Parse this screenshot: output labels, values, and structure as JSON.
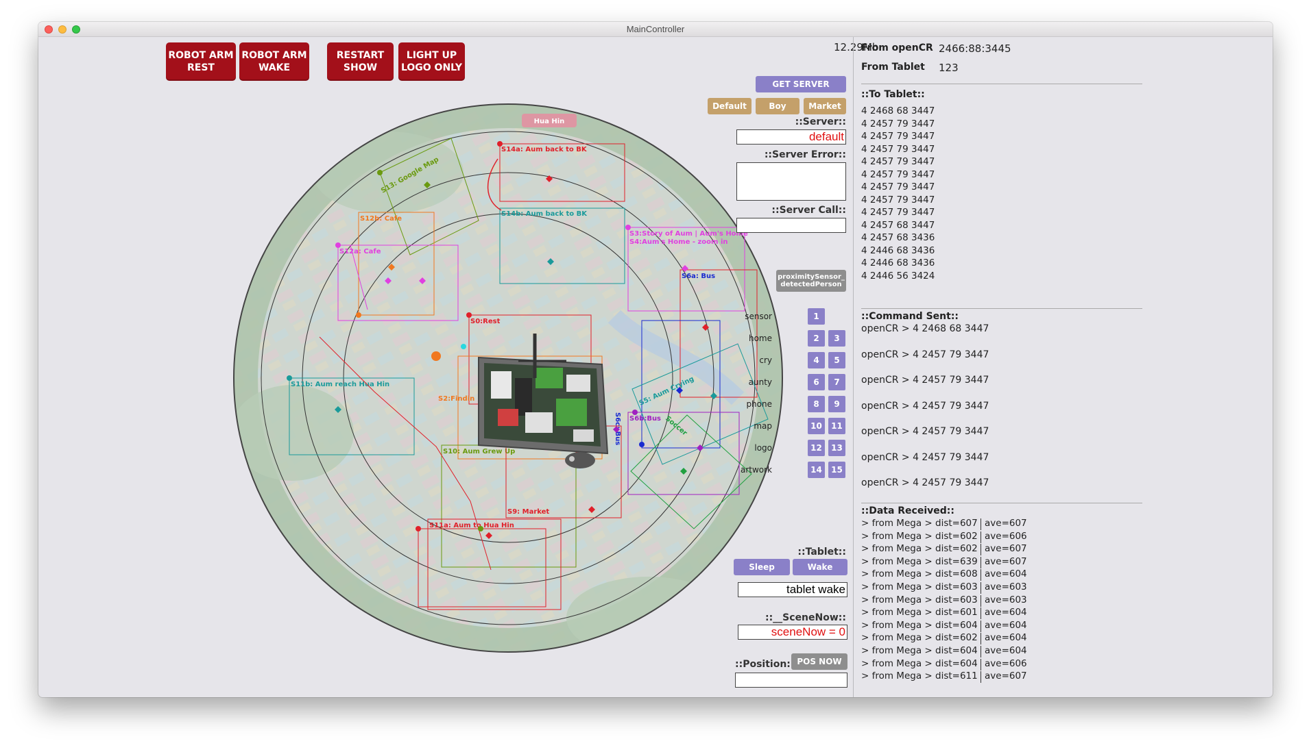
{
  "window": {
    "title": "MainController"
  },
  "top_buttons": [
    {
      "label": "ROBOT ARM\nREST"
    },
    {
      "label": "ROBOT ARM\nWAKE"
    },
    {
      "label": "RESTART\nSHOW"
    },
    {
      "label": "LIGHT UP\nLOGO ONLY"
    }
  ],
  "memory": "12.29Mb",
  "server": {
    "get_server_label": "GET SERVER",
    "presets": [
      "Default",
      "Boy",
      "Market"
    ],
    "server_label": "::Server::",
    "server_value": "default",
    "server_error_label": "::Server Error::",
    "server_error_value": "",
    "server_call_label": "::Server Call::",
    "server_call_value": ""
  },
  "proximity_button": "proximitySensor_\ndetectedPerson",
  "command_grid": [
    {
      "label": "sensor",
      "buttons": [
        "1"
      ]
    },
    {
      "label": "home",
      "buttons": [
        "2",
        "3"
      ]
    },
    {
      "label": "cry",
      "buttons": [
        "4",
        "5"
      ]
    },
    {
      "label": "aunty",
      "buttons": [
        "6",
        "7"
      ]
    },
    {
      "label": "phone",
      "buttons": [
        "8",
        "9"
      ]
    },
    {
      "label": "map",
      "buttons": [
        "10",
        "11"
      ]
    },
    {
      "label": "logo",
      "buttons": [
        "12",
        "13"
      ]
    },
    {
      "label": "artwork",
      "buttons": [
        "14",
        "15"
      ]
    }
  ],
  "tablet": {
    "label": "::Tablet::",
    "sleep_label": "Sleep",
    "wake_label": "Wake",
    "value": "tablet wake"
  },
  "scene_now": {
    "label": "::__SceneNow::",
    "value": "sceneNow = 0"
  },
  "position": {
    "label": "::Position::",
    "button": "POS NOW",
    "value": ""
  },
  "right_panel": {
    "from_opencr_label": "From openCR",
    "from_opencr_value": "2466:88:3445",
    "from_tablet_label": "From Tablet",
    "from_tablet_value": "123",
    "to_tablet_header": "::To Tablet::",
    "to_tablet_lines": [
      "4 2468 68 3447",
      "4 2457 79 3447",
      "4 2457 79 3447",
      "4 2457 79 3447",
      "4 2457 79 3447",
      "4 2457 79 3447",
      "4 2457 79 3447",
      "4 2457 79 3447",
      "4 2457 79 3447",
      "4 2457 68 3447",
      "4 2457 68 3436",
      "4 2446 68 3436",
      "4 2446 68 3436",
      "4 2446 56 3424"
    ],
    "command_sent_header": "::Command Sent::",
    "command_sent_lines": [
      "openCR > 4 2468 68 3447",
      "openCR > 4 2457 79 3447",
      "openCR > 4 2457 79 3447",
      "openCR > 4 2457 79 3447",
      "openCR > 4 2457 79 3447",
      "openCR > 4 2457 79 3447",
      "openCR > 4 2457 79 3447"
    ],
    "data_received_header": "::Data Received::",
    "data_received_lines": [
      {
        "left": "> from Mega > dist=607",
        "right": "ave=607"
      },
      {
        "left": "> from Mega > dist=602",
        "right": "ave=606"
      },
      {
        "left": "> from Mega > dist=602",
        "right": "ave=607"
      },
      {
        "left": "> from Mega > dist=639",
        "right": "ave=607"
      },
      {
        "left": "> from Mega > dist=608",
        "right": "ave=604"
      },
      {
        "left": "> from Mega > dist=603",
        "right": "ave=603"
      },
      {
        "left": "> from Mega > dist=603",
        "right": "ave=603"
      },
      {
        "left": "> from Mega > dist=601",
        "right": "ave=604"
      },
      {
        "left": "> from Mega > dist=604",
        "right": "ave=604"
      },
      {
        "left": "> from Mega > dist=602",
        "right": "ave=604"
      },
      {
        "left": "> from Mega > dist=604",
        "right": "ave=604"
      },
      {
        "left": "> from Mega > dist=604",
        "right": "ave=606"
      },
      {
        "left": "> from Mega > dist=611",
        "right": "ave=607"
      }
    ]
  },
  "map": {
    "town_label": "Hua Hin",
    "scenes": [
      {
        "label": "S14a: Aum back to BK",
        "color": "#e0202a"
      },
      {
        "label": "S14b: Aum back to BK",
        "color": "#1a9a9a"
      },
      {
        "label": "S13: Google Map",
        "color": "#6a9a10"
      },
      {
        "label": "S12b: Cafe",
        "color": "#f07820"
      },
      {
        "label": "S12a: Cafe",
        "color": "#e040e0"
      },
      {
        "label": "S3:Story of Aum | Aum's Home",
        "color": "#e040e0"
      },
      {
        "label": "S4:Aum's Home - zoom in",
        "color": "#e040e0"
      },
      {
        "label": "S6a: Bus",
        "color": "#1a2ad0"
      },
      {
        "label": "S0:Rest",
        "color": "#e0202a"
      },
      {
        "label": "S2:Findin",
        "color": "#f07820"
      },
      {
        "label": "S11b: Aum reach Hua Hin",
        "color": "#1a9a9a"
      },
      {
        "label": "S10: Aum Grew Up",
        "color": "#6a9a10"
      },
      {
        "label": "S9: Market",
        "color": "#e0202a"
      },
      {
        "label": "S11a: Aum to Hua Hin",
        "color": "#e0202a"
      },
      {
        "label": "S5: Aum Crying",
        "color": "#1a9a9a"
      },
      {
        "label": "S6b:Bus",
        "color": "#a020c0"
      },
      {
        "label": "S6c: Bus",
        "color": "#1a2ad0"
      },
      {
        "label": "Soccer",
        "color": "#20a040"
      }
    ]
  }
}
